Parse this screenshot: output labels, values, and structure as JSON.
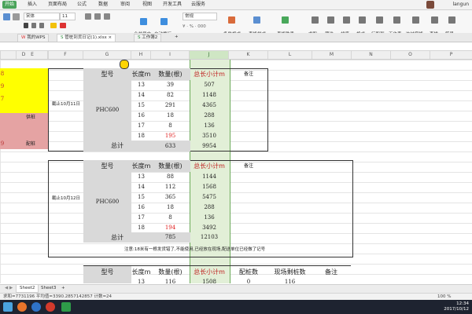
{
  "ribbon_tabs": [
    "开始",
    "插入",
    "页面布局",
    "公式",
    "数据",
    "审阅",
    "视图",
    "开发工具",
    "云服务"
  ],
  "user_name": "langun",
  "ribbon": {
    "font_name": "宋体",
    "font_size": "11",
    "number_format": "常规",
    "buttons": [
      "合并居中",
      "自动换行",
      "条件格式",
      "表格样式",
      "表格助手",
      "求和",
      "筛选",
      "排序",
      "格式",
      "行和列",
      "工作表",
      "冻结窗格",
      "查找",
      "符号"
    ]
  },
  "doc_tabs": [
    {
      "label": "我的WPS"
    },
    {
      "label": "管桩到货日记(1).xlsx"
    },
    {
      "label": "工作簿2"
    }
  ],
  "columns": [
    "D",
    "E",
    "F",
    "G",
    "H",
    "I",
    "J",
    "K",
    "L",
    "M",
    "N",
    "O",
    "P"
  ],
  "left_cells": [
    "8",
    "9",
    "7",
    "供桩",
    "9",
    "配桩"
  ],
  "table1": {
    "headers": [
      "型号",
      "长度m",
      "数量(根)",
      "总长小计m",
      "备注"
    ],
    "date_label": "截止10月11日",
    "model": "PHC600",
    "rows": [
      {
        "len": "13",
        "qty": "39",
        "total": "507"
      },
      {
        "len": "14",
        "qty": "82",
        "total": "1148"
      },
      {
        "len": "15",
        "qty": "291",
        "total": "4365"
      },
      {
        "len": "16",
        "qty": "18",
        "total": "288"
      },
      {
        "len": "17",
        "qty": "8",
        "total": "136"
      },
      {
        "len": "18",
        "qty": "195",
        "total": "3510"
      }
    ],
    "sum_label": "总计",
    "sum_qty": "633",
    "sum_total": "9954"
  },
  "table2": {
    "headers": [
      "型号",
      "长度m",
      "数量(根)",
      "总长小计m",
      "备注"
    ],
    "date_label": "截止10月12日",
    "model": "PHC600",
    "rows": [
      {
        "len": "13",
        "qty": "88",
        "total": "1144"
      },
      {
        "len": "14",
        "qty": "112",
        "total": "1568"
      },
      {
        "len": "15",
        "qty": "365",
        "total": "5475"
      },
      {
        "len": "16",
        "qty": "18",
        "total": "288"
      },
      {
        "len": "17",
        "qty": "8",
        "total": "136"
      },
      {
        "len": "18",
        "qty": "194",
        "total": "3492"
      }
    ],
    "sum_label": "总计",
    "sum_qty": "785",
    "sum_total": "12103",
    "note": "注意:18米有一根发货错了,不能使用,已经放在现场,配送单位已经做了记号"
  },
  "table3": {
    "headers": [
      "型号",
      "长度m",
      "数量(根)",
      "总长小计m",
      "配桩数",
      "现场剩桩数",
      "备注"
    ],
    "row": {
      "len": "13",
      "qty": "116",
      "total": "1508",
      "pei": "0",
      "left": "116"
    }
  },
  "sheet_tabs": [
    "Sheet2",
    "Sheet3",
    "+"
  ],
  "status_text": "求和=7731196  平均值=3390.2857142857  计数=24",
  "zoom": "100 %",
  "clock_time": "12:34",
  "clock_date": "2017/10/12"
}
